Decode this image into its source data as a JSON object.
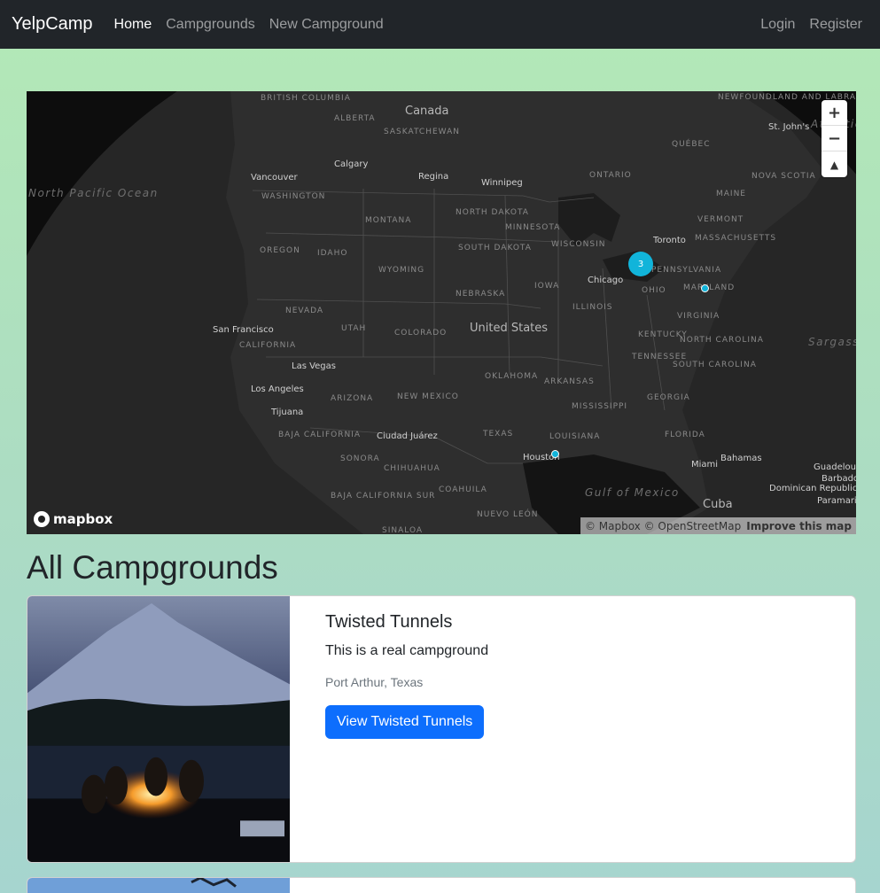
{
  "nav": {
    "brand": "YelpCamp",
    "links": [
      "Home",
      "Campgrounds",
      "New Campground"
    ],
    "right_links": [
      "Login",
      "Register"
    ]
  },
  "map": {
    "labels": {
      "countries": [
        "Canada",
        "United States"
      ],
      "cities": [
        "Vancouver",
        "Calgary",
        "Regina",
        "Winnipeg",
        "Toronto",
        "Chicago",
        "San Francisco",
        "Las Vegas",
        "Los Angeles",
        "Tijuana",
        "Ciudad Juárez",
        "Houston",
        "Miami",
        "Cuba",
        "Bahamas",
        "St. John's",
        "Guadeloupe",
        "Barbados",
        "Dominican Republic",
        "Paramaribo"
      ],
      "states": [
        "BRITISH COLUMBIA",
        "ALBERTA",
        "SASKATCHEWAN",
        "QUÉBEC",
        "ONTARIO",
        "NOVA SCOTIA",
        "WASHINGTON",
        "MONTANA",
        "NORTH DAKOTA",
        "MINNESOTA",
        "MAINE",
        "VERMONT",
        "MASSACHUSETTS",
        "OREGON",
        "IDAHO",
        "WYOMING",
        "SOUTH DAKOTA",
        "WISCONSIN",
        "IOWA",
        "NEBRASKA",
        "PENNSYLVANIA",
        "OHIO",
        "ILLINOIS",
        "MARYLAND",
        "NEVADA",
        "UTAH",
        "COLORADO",
        "VIRGINIA",
        "KENTUCKY",
        "CALIFORNIA",
        "NORTH CAROLINA",
        "TENNESSEE",
        "OKLAHOMA",
        "ARKANSAS",
        "SOUTH CAROLINA",
        "ARIZONA",
        "NEW MEXICO",
        "MISSISSIPPI",
        "GEORGIA",
        "TEXAS",
        "LOUISIANA",
        "FLORIDA",
        "BAJA CALIFORNIA",
        "SONORA",
        "CHIHUAHUA",
        "COAHUILA",
        "NUEVO LEÓN",
        "BAJA CALIFORNIA SUR",
        "SINALOA",
        "NEWFOUNDLAND AND LABRADOR"
      ],
      "waters": [
        "North Pacific Ocean",
        "Sargasso Sea",
        "Gulf of Mexico",
        "Atlantic"
      ]
    },
    "cluster_count": "3",
    "zoom_in": "+",
    "zoom_out": "−",
    "compass": "▲",
    "logo_text": "mapbox",
    "attribution": "© Mapbox © OpenStreetMap",
    "improve": "Improve this map"
  },
  "page_title": "All Campgrounds",
  "campgrounds": [
    {
      "title": "Twisted Tunnels",
      "description": "This is a real campground",
      "location": "Port Arthur, Texas",
      "button": "View Twisted Tunnels"
    }
  ],
  "colors": {
    "navbar": "#212529",
    "primary_button": "#0d6efd",
    "cluster": "#11b4da",
    "map_bg": "#0d0d0d"
  }
}
